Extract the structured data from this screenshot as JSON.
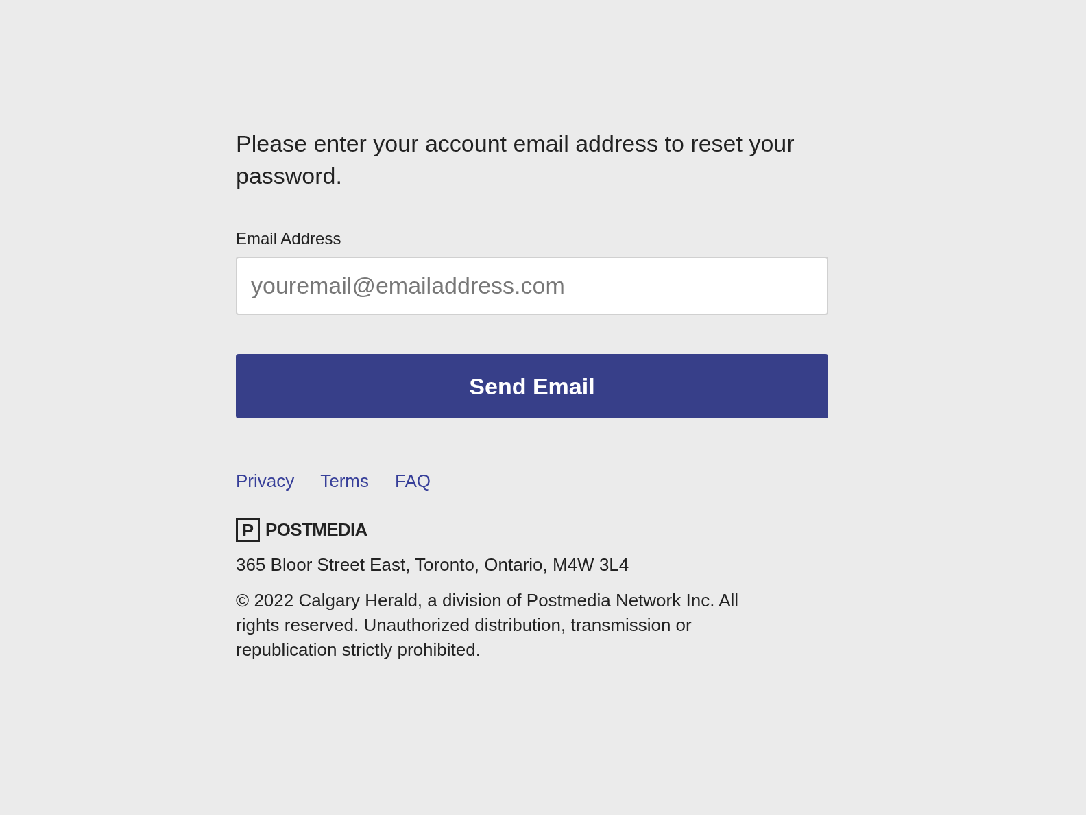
{
  "intro": "Please enter your account email address to reset your password.",
  "email_field": {
    "label": "Email Address",
    "placeholder": "youremail@emailaddress.com"
  },
  "submit_button": "Send Email",
  "footer_links": [
    "Privacy",
    "Terms",
    "FAQ"
  ],
  "logo": {
    "mark": "P",
    "name": "POSTMEDIA"
  },
  "address": "365 Bloor Street East, Toronto, Ontario, M4W 3L4",
  "copyright": "© 2022 Calgary Herald, a division of Postmedia Network Inc. All rights reserved. Unauthorized distribution, transmission or republication strictly prohibited."
}
